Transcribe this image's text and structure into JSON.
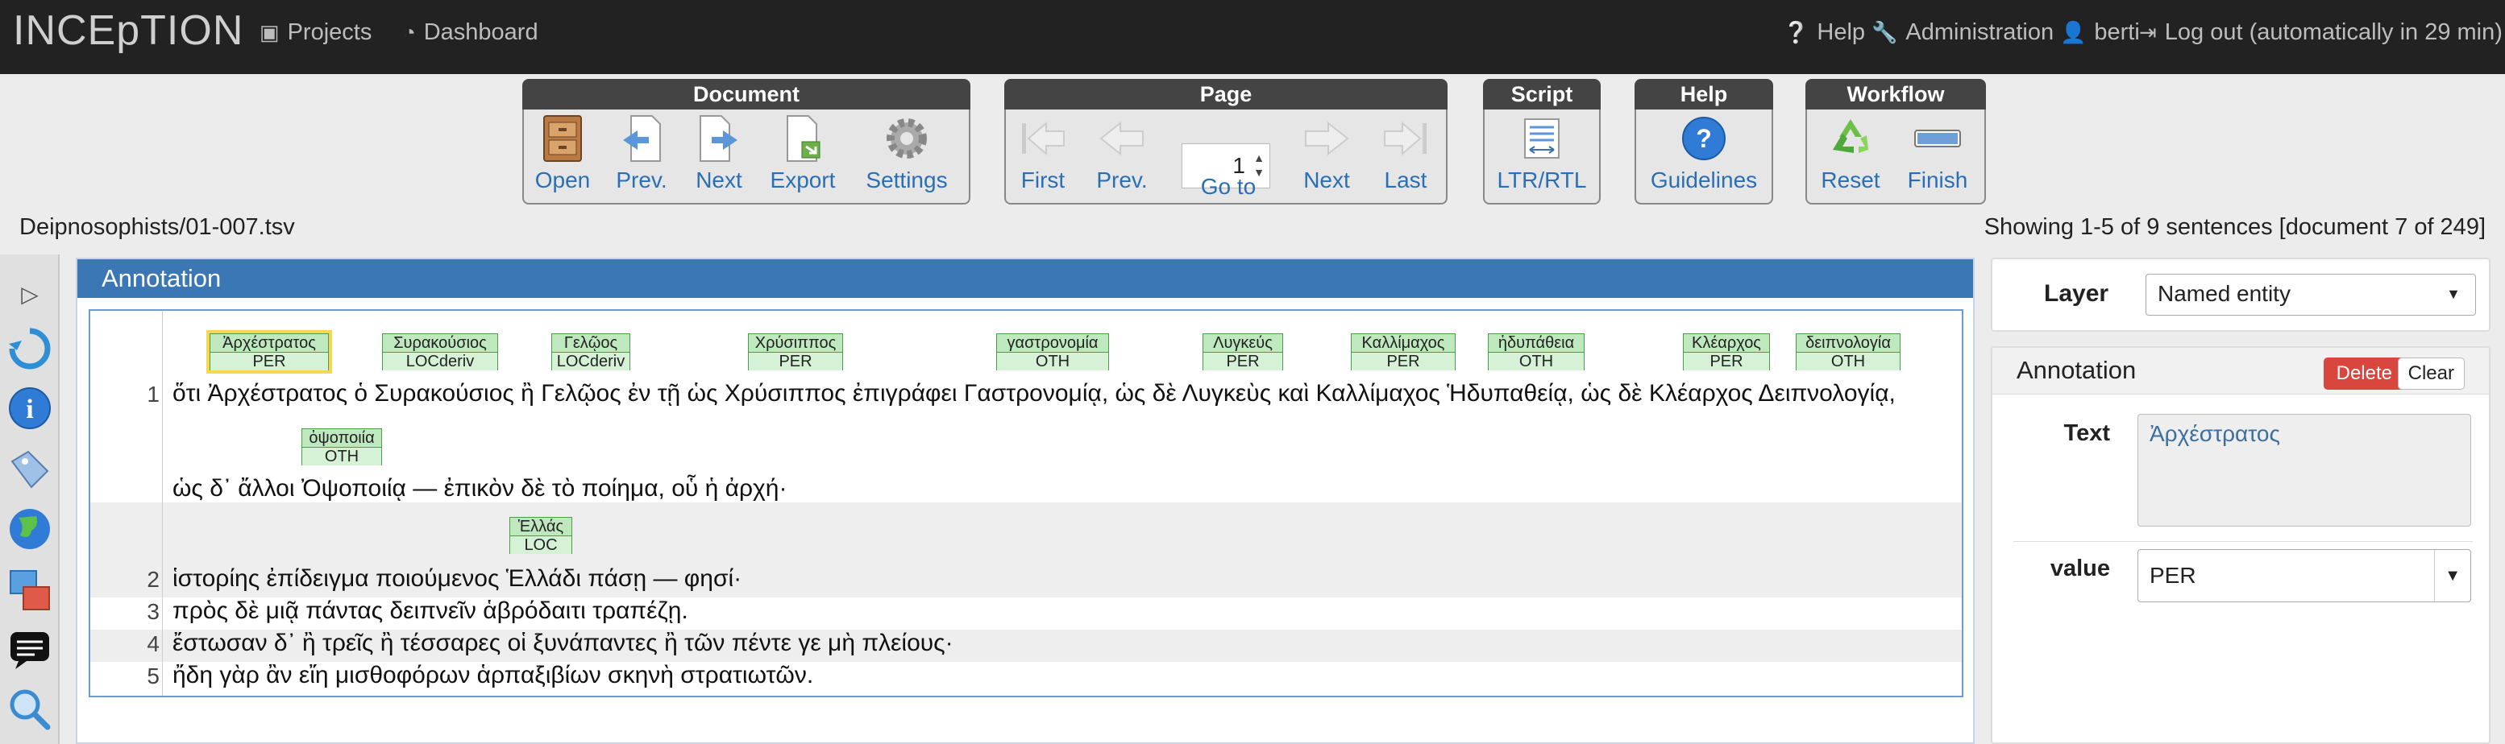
{
  "app": {
    "brand": "INCEpTION"
  },
  "nav": {
    "projects": "Projects",
    "dashboard": "Dashboard",
    "help": "Help",
    "administration": "Administration",
    "user": "berti",
    "logout": "Log out (automatically in 29 min)"
  },
  "toolbar": {
    "document": {
      "title": "Document",
      "open": "Open",
      "prev": "Prev.",
      "next": "Next",
      "export": "Export",
      "settings": "Settings"
    },
    "page": {
      "title": "Page",
      "first": "First",
      "prev": "Prev.",
      "goto": "Go to",
      "next": "Next",
      "last": "Last",
      "value": "1"
    },
    "script": {
      "title": "Script",
      "ltr_rtl": "LTR/RTL"
    },
    "help": {
      "title": "Help",
      "guidelines": "Guidelines"
    },
    "workflow": {
      "title": "Workflow",
      "reset": "Reset",
      "finish": "Finish"
    }
  },
  "doc": {
    "name": "Deipnosophists/01-007.tsv",
    "showing": "Showing 1-5 of 9 sentences [document 7 of 249]"
  },
  "annotation_panel": {
    "title": "Annotation",
    "sentences": [
      {
        "num": "1",
        "line1": "ὅτι Ἀρχέστρατος ὁ Συρακούσιος ἢ  Γελῷος  ἐν τῇ ὡς Χρύσιππος ἐπιγράφει Γαστρονομίᾳ, ὡς δὲ Λυγκεὺς καὶ Καλλίμαχος Ἡδυπαθείᾳ, ὡς δὲ Κλέαρχος Δειπνολογίᾳ,",
        "line2": "ὡς δ᾽ ἄλλοι Ὀψοποιίᾳ — ἐπικὸν δὲ τὸ ποίημα, οὗ ἡ ἀρχή·"
      },
      {
        "num": "2",
        "text": "ἱστορίης ἐπίδειγμα ποιούμενος Ἑλλάδι πάσῃ — φησί·"
      },
      {
        "num": "3",
        "text": "πρὸς δὲ μιᾷ πάντας δειπνεῖν ἁβρόδαιτι τραπέζῃ."
      },
      {
        "num": "4",
        "text": "ἔστωσαν δ᾽ ἢ τρεῖς ἢ τέσσαρες οἱ ξυνάπαντες ἢ τῶν πέντε γε μὴ πλείους·"
      },
      {
        "num": "5",
        "text": "ἤδη γὰρ ἂν εἴη μισθοφόρων ἁρπαξιβίων σκηνὴ στρατιωτῶν."
      }
    ],
    "labels": [
      {
        "token": "Ἀρχέστρατος",
        "type": "PER"
      },
      {
        "token": "Συρακούσιος",
        "type": "LOCderiv"
      },
      {
        "token": "Γελῷος",
        "type": "LOCderiv"
      },
      {
        "token": "Χρύσιππος",
        "type": "PER"
      },
      {
        "token": "γαστρονομία",
        "type": "OTH"
      },
      {
        "token": "Λυγκεύς",
        "type": "PER"
      },
      {
        "token": "Καλλίμαχος",
        "type": "PER"
      },
      {
        "token": "ἡδυπάθεια",
        "type": "OTH"
      },
      {
        "token": "Κλέαρχος",
        "type": "PER"
      },
      {
        "token": "δειπνολογία",
        "type": "OTH"
      },
      {
        "token": "ὀψοποιία",
        "type": "OTH"
      },
      {
        "token": "Ἑλλάς",
        "type": "LOC"
      }
    ]
  },
  "right_panel": {
    "layer_label": "Layer",
    "layer_value": "Named entity",
    "annotation_title": "Annotation",
    "delete": "Delete",
    "clear": "Clear",
    "text_label": "Text",
    "text_value": "Ἀρχέστρατος",
    "value_label": "value",
    "value_value": "PER"
  }
}
